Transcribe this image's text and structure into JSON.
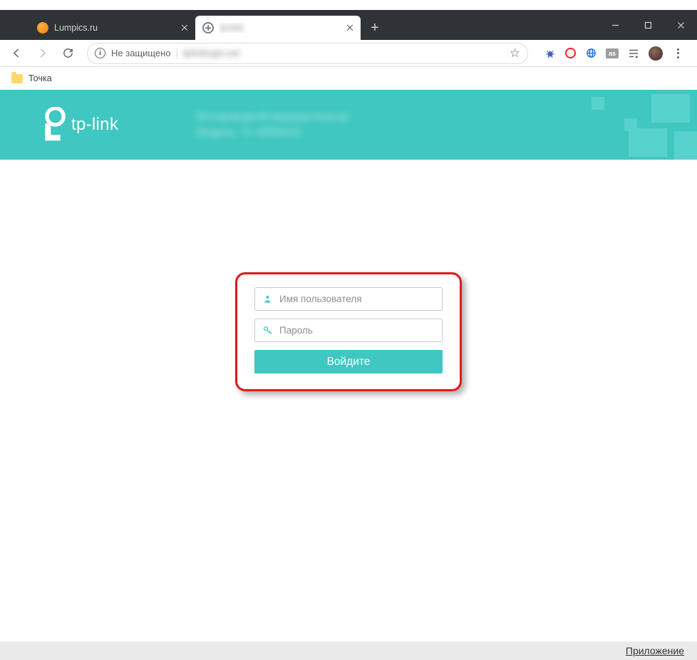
{
  "browser": {
    "tabs": [
      {
        "title": "Lumpics.ru",
        "active": false,
        "favicon": "orange-circle"
      },
      {
        "title": "tp-link",
        "active": true,
        "favicon": "globe"
      }
    ],
    "window_controls": {
      "minimize": "minimize",
      "maximize": "maximize",
      "close": "close"
    },
    "nav": {
      "back": "back",
      "forward": "forward",
      "reload": "reload"
    },
    "address_bar": {
      "security_label": "Не защищено",
      "url": "tplinklogin.net",
      "star": "bookmark-star"
    },
    "extensions": [
      "crab-icon",
      "opera-icon",
      "globe-icon",
      "as-badge",
      "cast-icon",
      "avatar",
      "kebab-menu"
    ]
  },
  "bookmarks_bar": {
    "items": [
      {
        "label": "Точка",
        "icon": "folder"
      }
    ]
  },
  "page": {
    "brand": "tp-link",
    "header_line1": "Беспроводной маршрутизатор",
    "header_line2": "Модель: TL-WR841N",
    "login": {
      "username_placeholder": "Имя пользователя",
      "password_placeholder": "Пароль",
      "submit_label": "Войдите"
    },
    "footer_link": "Приложение"
  }
}
